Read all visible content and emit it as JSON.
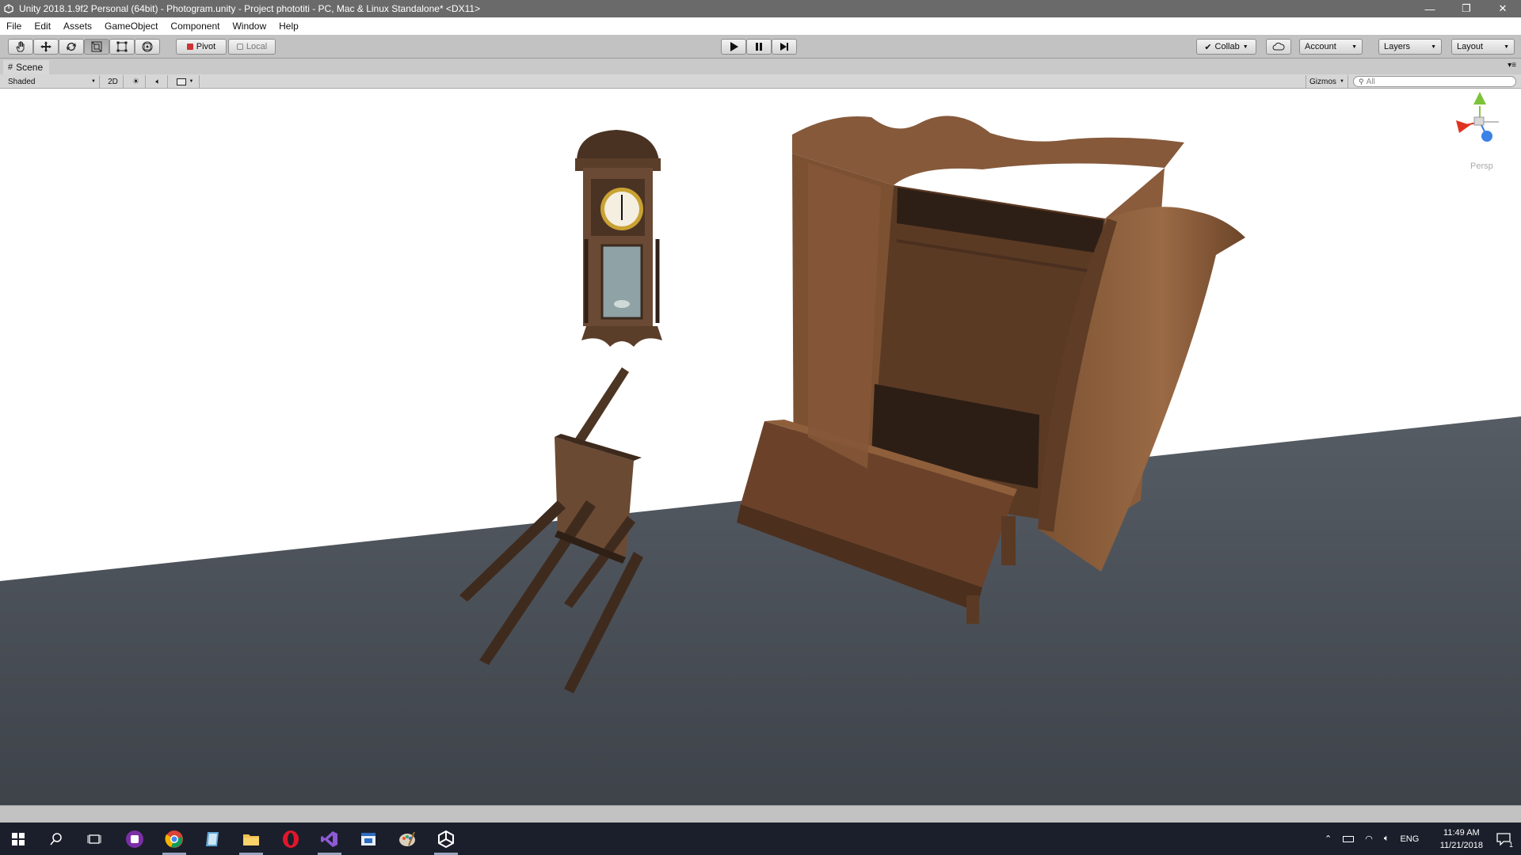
{
  "window": {
    "title": "Unity 2018.1.9f2 Personal (64bit) - Photogram.unity - Project phototiti - PC, Mac & Linux Standalone* <DX11>",
    "minimize": "—",
    "restore": "❐",
    "close": "✕"
  },
  "menu": [
    "File",
    "Edit",
    "Assets",
    "GameObject",
    "Component",
    "Window",
    "Help"
  ],
  "toolbar": {
    "pivot": "Pivot",
    "local": "Local",
    "collab": "Collab",
    "account": "Account",
    "layers": "Layers",
    "layout": "Layout"
  },
  "scene": {
    "tab_label": "Scene",
    "shading_mode": "Shaded",
    "mode_2d": "2D",
    "gizmos": "Gizmos",
    "search_placeholder": "All",
    "persp_label": "Persp"
  },
  "taskbar": {
    "language": "ENG",
    "time": "11:49 AM",
    "date": "11/21/2018",
    "notification_count": "1"
  },
  "colors": {
    "titlebar": "#6a6a6a",
    "editor_bg": "#c2c2c2",
    "viewport_bg": "#ffffff",
    "floor": "#4a5058",
    "wood": "#7a5236",
    "taskbar": "#1b1f2b"
  }
}
